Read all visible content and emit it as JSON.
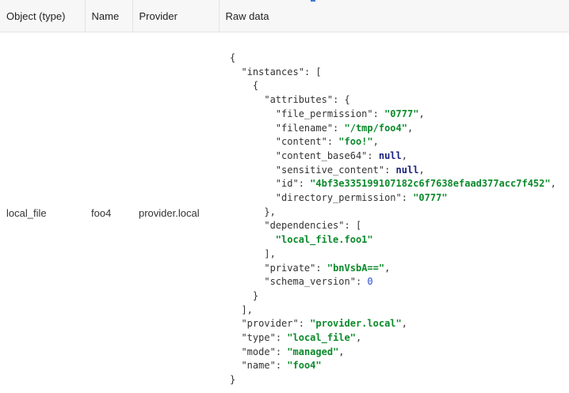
{
  "table": {
    "headers": [
      "Object (type)",
      "Name",
      "Provider",
      "Raw data"
    ],
    "row": {
      "object_type": "local_file",
      "name": "foo4",
      "provider": "provider.local"
    }
  },
  "raw_data": {
    "lines": [
      [
        {
          "t": "p",
          "v": "{"
        }
      ],
      [
        {
          "t": "p",
          "v": "  "
        },
        {
          "t": "k",
          "v": "\"instances\""
        },
        {
          "t": "p",
          "v": ": ["
        }
      ],
      [
        {
          "t": "p",
          "v": "    {"
        }
      ],
      [
        {
          "t": "p",
          "v": "      "
        },
        {
          "t": "k",
          "v": "\"attributes\""
        },
        {
          "t": "p",
          "v": ": {"
        }
      ],
      [
        {
          "t": "p",
          "v": "        "
        },
        {
          "t": "k",
          "v": "\"file_permission\""
        },
        {
          "t": "p",
          "v": ": "
        },
        {
          "t": "s",
          "v": "\"0777\""
        },
        {
          "t": "p",
          "v": ","
        }
      ],
      [
        {
          "t": "p",
          "v": "        "
        },
        {
          "t": "k",
          "v": "\"filename\""
        },
        {
          "t": "p",
          "v": ": "
        },
        {
          "t": "s",
          "v": "\"/tmp/foo4\""
        },
        {
          "t": "p",
          "v": ","
        }
      ],
      [
        {
          "t": "p",
          "v": "        "
        },
        {
          "t": "k",
          "v": "\"content\""
        },
        {
          "t": "p",
          "v": ": "
        },
        {
          "t": "s",
          "v": "\"foo!\""
        },
        {
          "t": "p",
          "v": ","
        }
      ],
      [
        {
          "t": "p",
          "v": "        "
        },
        {
          "t": "k",
          "v": "\"content_base64\""
        },
        {
          "t": "p",
          "v": ": "
        },
        {
          "t": "w",
          "v": "null"
        },
        {
          "t": "p",
          "v": ","
        }
      ],
      [
        {
          "t": "p",
          "v": "        "
        },
        {
          "t": "k",
          "v": "\"sensitive_content\""
        },
        {
          "t": "p",
          "v": ": "
        },
        {
          "t": "w",
          "v": "null"
        },
        {
          "t": "p",
          "v": ","
        }
      ],
      [
        {
          "t": "p",
          "v": "        "
        },
        {
          "t": "k",
          "v": "\"id\""
        },
        {
          "t": "p",
          "v": ": "
        },
        {
          "t": "s",
          "v": "\"4bf3e335199107182c6f7638efaad377acc7f452\""
        },
        {
          "t": "p",
          "v": ","
        }
      ],
      [
        {
          "t": "p",
          "v": "        "
        },
        {
          "t": "k",
          "v": "\"directory_permission\""
        },
        {
          "t": "p",
          "v": ": "
        },
        {
          "t": "s",
          "v": "\"0777\""
        }
      ],
      [
        {
          "t": "p",
          "v": "      },"
        }
      ],
      [
        {
          "t": "p",
          "v": "      "
        },
        {
          "t": "k",
          "v": "\"dependencies\""
        },
        {
          "t": "p",
          "v": ": ["
        }
      ],
      [
        {
          "t": "p",
          "v": "        "
        },
        {
          "t": "s",
          "v": "\"local_file.foo1\""
        }
      ],
      [
        {
          "t": "p",
          "v": "      ],"
        }
      ],
      [
        {
          "t": "p",
          "v": "      "
        },
        {
          "t": "k",
          "v": "\"private\""
        },
        {
          "t": "p",
          "v": ": "
        },
        {
          "t": "s",
          "v": "\"bnVsbA==\""
        },
        {
          "t": "p",
          "v": ","
        }
      ],
      [
        {
          "t": "p",
          "v": "      "
        },
        {
          "t": "k",
          "v": "\"schema_version\""
        },
        {
          "t": "p",
          "v": ": "
        },
        {
          "t": "n",
          "v": "0"
        }
      ],
      [
        {
          "t": "p",
          "v": "    }"
        }
      ],
      [
        {
          "t": "p",
          "v": "  ],"
        }
      ],
      [
        {
          "t": "p",
          "v": "  "
        },
        {
          "t": "k",
          "v": "\"provider\""
        },
        {
          "t": "p",
          "v": ": "
        },
        {
          "t": "s",
          "v": "\"provider.local\""
        },
        {
          "t": "p",
          "v": ","
        }
      ],
      [
        {
          "t": "p",
          "v": "  "
        },
        {
          "t": "k",
          "v": "\"type\""
        },
        {
          "t": "p",
          "v": ": "
        },
        {
          "t": "s",
          "v": "\"local_file\""
        },
        {
          "t": "p",
          "v": ","
        }
      ],
      [
        {
          "t": "p",
          "v": "  "
        },
        {
          "t": "k",
          "v": "\"mode\""
        },
        {
          "t": "p",
          "v": ": "
        },
        {
          "t": "s",
          "v": "\"managed\""
        },
        {
          "t": "p",
          "v": ","
        }
      ],
      [
        {
          "t": "p",
          "v": "  "
        },
        {
          "t": "k",
          "v": "\"name\""
        },
        {
          "t": "p",
          "v": ": "
        },
        {
          "t": "s",
          "v": "\"foo4\""
        }
      ],
      [
        {
          "t": "p",
          "v": "}"
        }
      ]
    ]
  },
  "colors": {
    "string": "#0b8a2b",
    "keyword": "#1a237e",
    "number": "#2a48d8",
    "header_bg": "#f7f7f7",
    "accent": "#3d7bd6"
  }
}
